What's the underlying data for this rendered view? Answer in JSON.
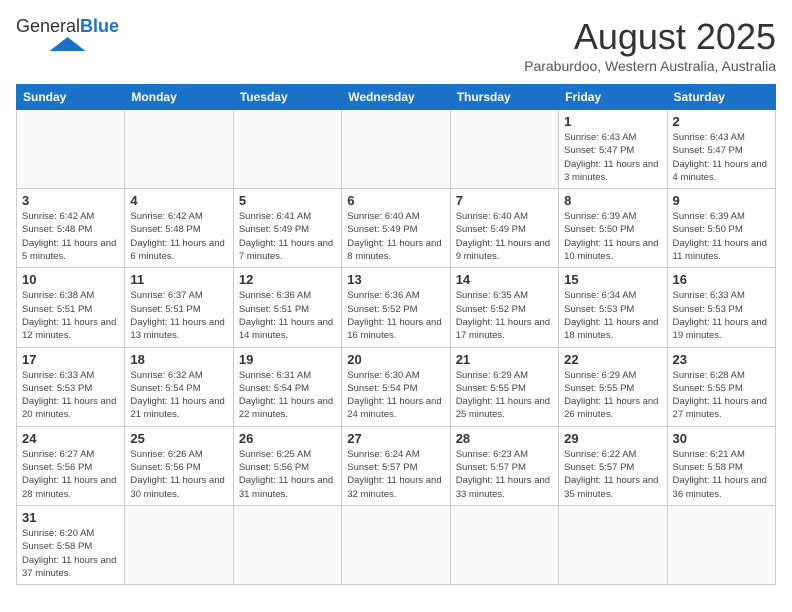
{
  "header": {
    "logo_text_general": "General",
    "logo_text_blue": "Blue",
    "month_year": "August 2025",
    "location": "Paraburdoo, Western Australia, Australia"
  },
  "weekdays": [
    "Sunday",
    "Monday",
    "Tuesday",
    "Wednesday",
    "Thursday",
    "Friday",
    "Saturday"
  ],
  "weeks": [
    [
      {
        "day": "",
        "info": ""
      },
      {
        "day": "",
        "info": ""
      },
      {
        "day": "",
        "info": ""
      },
      {
        "day": "",
        "info": ""
      },
      {
        "day": "",
        "info": ""
      },
      {
        "day": "1",
        "info": "Sunrise: 6:43 AM\nSunset: 5:47 PM\nDaylight: 11 hours and 3 minutes."
      },
      {
        "day": "2",
        "info": "Sunrise: 6:43 AM\nSunset: 5:47 PM\nDaylight: 11 hours and 4 minutes."
      }
    ],
    [
      {
        "day": "3",
        "info": "Sunrise: 6:42 AM\nSunset: 5:48 PM\nDaylight: 11 hours and 5 minutes."
      },
      {
        "day": "4",
        "info": "Sunrise: 6:42 AM\nSunset: 5:48 PM\nDaylight: 11 hours and 6 minutes."
      },
      {
        "day": "5",
        "info": "Sunrise: 6:41 AM\nSunset: 5:49 PM\nDaylight: 11 hours and 7 minutes."
      },
      {
        "day": "6",
        "info": "Sunrise: 6:40 AM\nSunset: 5:49 PM\nDaylight: 11 hours and 8 minutes."
      },
      {
        "day": "7",
        "info": "Sunrise: 6:40 AM\nSunset: 5:49 PM\nDaylight: 11 hours and 9 minutes."
      },
      {
        "day": "8",
        "info": "Sunrise: 6:39 AM\nSunset: 5:50 PM\nDaylight: 11 hours and 10 minutes."
      },
      {
        "day": "9",
        "info": "Sunrise: 6:39 AM\nSunset: 5:50 PM\nDaylight: 11 hours and 11 minutes."
      }
    ],
    [
      {
        "day": "10",
        "info": "Sunrise: 6:38 AM\nSunset: 5:51 PM\nDaylight: 11 hours and 12 minutes."
      },
      {
        "day": "11",
        "info": "Sunrise: 6:37 AM\nSunset: 5:51 PM\nDaylight: 11 hours and 13 minutes."
      },
      {
        "day": "12",
        "info": "Sunrise: 6:36 AM\nSunset: 5:51 PM\nDaylight: 11 hours and 14 minutes."
      },
      {
        "day": "13",
        "info": "Sunrise: 6:36 AM\nSunset: 5:52 PM\nDaylight: 11 hours and 16 minutes."
      },
      {
        "day": "14",
        "info": "Sunrise: 6:35 AM\nSunset: 5:52 PM\nDaylight: 11 hours and 17 minutes."
      },
      {
        "day": "15",
        "info": "Sunrise: 6:34 AM\nSunset: 5:53 PM\nDaylight: 11 hours and 18 minutes."
      },
      {
        "day": "16",
        "info": "Sunrise: 6:33 AM\nSunset: 5:53 PM\nDaylight: 11 hours and 19 minutes."
      }
    ],
    [
      {
        "day": "17",
        "info": "Sunrise: 6:33 AM\nSunset: 5:53 PM\nDaylight: 11 hours and 20 minutes."
      },
      {
        "day": "18",
        "info": "Sunrise: 6:32 AM\nSunset: 5:54 PM\nDaylight: 11 hours and 21 minutes."
      },
      {
        "day": "19",
        "info": "Sunrise: 6:31 AM\nSunset: 5:54 PM\nDaylight: 11 hours and 22 minutes."
      },
      {
        "day": "20",
        "info": "Sunrise: 6:30 AM\nSunset: 5:54 PM\nDaylight: 11 hours and 24 minutes."
      },
      {
        "day": "21",
        "info": "Sunrise: 6:29 AM\nSunset: 5:55 PM\nDaylight: 11 hours and 25 minutes."
      },
      {
        "day": "22",
        "info": "Sunrise: 6:29 AM\nSunset: 5:55 PM\nDaylight: 11 hours and 26 minutes."
      },
      {
        "day": "23",
        "info": "Sunrise: 6:28 AM\nSunset: 5:55 PM\nDaylight: 11 hours and 27 minutes."
      }
    ],
    [
      {
        "day": "24",
        "info": "Sunrise: 6:27 AM\nSunset: 5:56 PM\nDaylight: 11 hours and 28 minutes."
      },
      {
        "day": "25",
        "info": "Sunrise: 6:26 AM\nSunset: 5:56 PM\nDaylight: 11 hours and 30 minutes."
      },
      {
        "day": "26",
        "info": "Sunrise: 6:25 AM\nSunset: 5:56 PM\nDaylight: 11 hours and 31 minutes."
      },
      {
        "day": "27",
        "info": "Sunrise: 6:24 AM\nSunset: 5:57 PM\nDaylight: 11 hours and 32 minutes."
      },
      {
        "day": "28",
        "info": "Sunrise: 6:23 AM\nSunset: 5:57 PM\nDaylight: 11 hours and 33 minutes."
      },
      {
        "day": "29",
        "info": "Sunrise: 6:22 AM\nSunset: 5:57 PM\nDaylight: 11 hours and 35 minutes."
      },
      {
        "day": "30",
        "info": "Sunrise: 6:21 AM\nSunset: 5:58 PM\nDaylight: 11 hours and 36 minutes."
      }
    ],
    [
      {
        "day": "31",
        "info": "Sunrise: 6:20 AM\nSunset: 5:58 PM\nDaylight: 11 hours and 37 minutes."
      },
      {
        "day": "",
        "info": ""
      },
      {
        "day": "",
        "info": ""
      },
      {
        "day": "",
        "info": ""
      },
      {
        "day": "",
        "info": ""
      },
      {
        "day": "",
        "info": ""
      },
      {
        "day": "",
        "info": ""
      }
    ]
  ]
}
